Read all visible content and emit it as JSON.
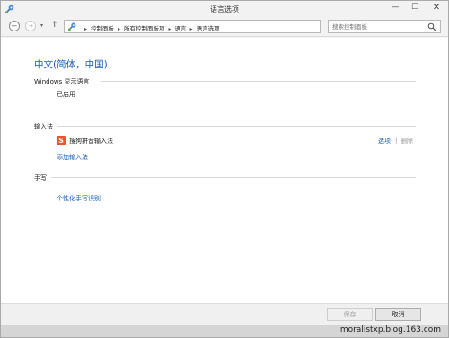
{
  "window": {
    "title": "语言选项",
    "controls": {
      "minimize": "—",
      "maximize": "☐",
      "close": "✕"
    }
  },
  "nav": {
    "back": "←",
    "forward": "→",
    "recent": "▾",
    "up": "↑",
    "breadcrumbs": [
      "控制面板",
      "所有控制面板项",
      "语言",
      "语言选项"
    ],
    "crumb_sep": "▸",
    "address_dropdown": "▾",
    "refresh": "↻",
    "search_placeholder": "搜索控制面板"
  },
  "language": {
    "heading": "中文(简体，中国)",
    "display_section": "Windows 显示语言",
    "display_status": "已启用",
    "ime_section": "输入法",
    "ime_name": "搜狗拼音输入法",
    "ime_options": "选项",
    "ime_sep": "|",
    "ime_delete": "删除",
    "add_ime": "添加输入法",
    "handwriting_section": "手写",
    "personalize_handwriting": "个性化手写识别"
  },
  "footer": {
    "save": "保存",
    "cancel": "取消"
  },
  "watermark": "moralistxp.blog.163.com",
  "colors": {
    "link": "#1a5fb4",
    "ime_icon": "#e8562a"
  }
}
